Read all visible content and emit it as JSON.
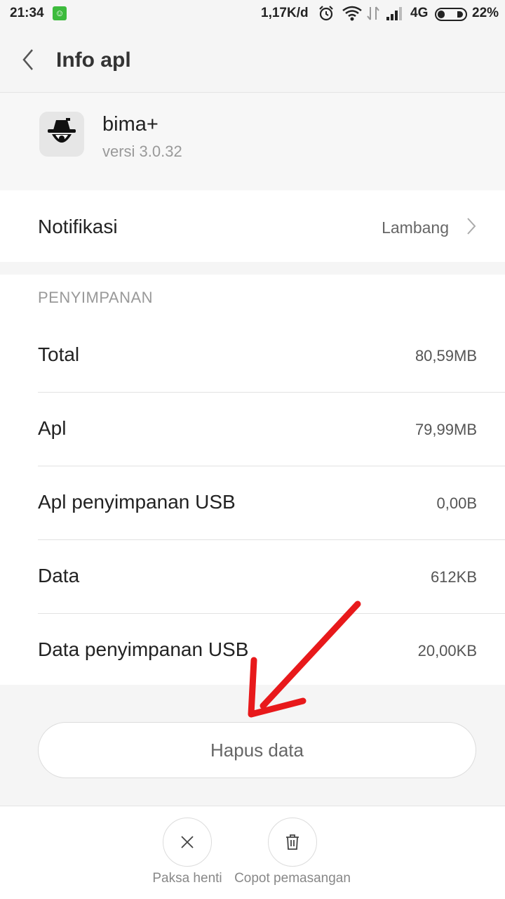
{
  "status_bar": {
    "time": "21:34",
    "speed": "1,17K/d",
    "network": "4G",
    "battery": "22%"
  },
  "header": {
    "title": "Info apl"
  },
  "app": {
    "name": "bima+",
    "version": "versi 3.0.32"
  },
  "notifications": {
    "label": "Notifikasi",
    "value": "Lambang"
  },
  "storage": {
    "section_title": "PENYIMPANAN",
    "rows": [
      {
        "label": "Total",
        "value": "80,59MB"
      },
      {
        "label": "Apl",
        "value": "79,99MB"
      },
      {
        "label": "Apl penyimpanan USB",
        "value": "0,00B"
      },
      {
        "label": "Data",
        "value": "612KB"
      },
      {
        "label": "Data penyimpanan USB",
        "value": "20,00KB"
      }
    ]
  },
  "actions": {
    "clear_data": "Hapus data",
    "force_stop": "Paksa henti",
    "uninstall": "Copot pemasangan"
  },
  "colors": {
    "annotation_arrow": "#e8191b",
    "notification_icon": "#3dbb3d"
  }
}
